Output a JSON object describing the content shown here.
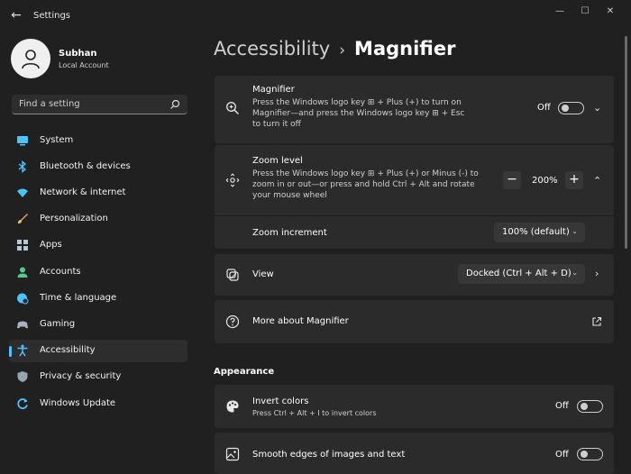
{
  "window": {
    "title": "Settings",
    "minimize_glyph": "—",
    "maximize_glyph": "☐",
    "close_glyph": "✕",
    "back_glyph": "←"
  },
  "user": {
    "name": "Subhan",
    "account_type": "Local Account"
  },
  "search": {
    "placeholder": "Find a setting"
  },
  "nav": {
    "accent_color": "#4cc2ff",
    "items": [
      {
        "label": "System",
        "icon": "monitor-icon"
      },
      {
        "label": "Bluetooth & devices",
        "icon": "bluetooth-icon"
      },
      {
        "label": "Network & internet",
        "icon": "wifi-icon"
      },
      {
        "label": "Personalization",
        "icon": "brush-icon"
      },
      {
        "label": "Apps",
        "icon": "apps-grid-icon"
      },
      {
        "label": "Accounts",
        "icon": "person-icon"
      },
      {
        "label": "Time & language",
        "icon": "globe-clock-icon"
      },
      {
        "label": "Gaming",
        "icon": "gamepad-icon"
      },
      {
        "label": "Accessibility",
        "icon": "accessibility-icon",
        "active": true
      },
      {
        "label": "Privacy & security",
        "icon": "shield-icon"
      },
      {
        "label": "Windows Update",
        "icon": "update-icon"
      }
    ]
  },
  "breadcrumb": {
    "parent": "Accessibility",
    "separator": "›",
    "current": "Magnifier"
  },
  "magnifier": {
    "title": "Magnifier",
    "desc_line1": "Press the Windows logo key ⊞ + Plus (+) to turn on",
    "desc_line2": "Magnifier—and press the Windows logo key ⊞ + Esc",
    "desc_line3": "to turn it off",
    "state": "Off",
    "icon": "magnifier-icon"
  },
  "zoom_level": {
    "title": "Zoom level",
    "desc_line1": "Press the Windows logo key ⊞ + Plus (+) or Minus (-) to",
    "desc_line2": "zoom in or out—or press and hold Ctrl + Alt and rotate",
    "desc_line3": "your mouse wheel",
    "value": "200%",
    "minus": "−",
    "plus": "+",
    "icon": "zoom-level-icon"
  },
  "zoom_increment": {
    "label": "Zoom increment",
    "selected": "100% (default)"
  },
  "view": {
    "title": "View",
    "selected": "Docked (Ctrl + Alt + D)",
    "icon": "view-icon"
  },
  "more_about": {
    "title": "More about Magnifier",
    "icon": "help-icon"
  },
  "appearance": {
    "heading": "Appearance",
    "invert_colors": {
      "title": "Invert colors",
      "desc": "Press Ctrl + Alt + I to invert colors",
      "state": "Off",
      "icon": "palette-icon"
    },
    "smooth_edges": {
      "title": "Smooth edges of images and text",
      "state": "Off",
      "icon": "image-icon"
    }
  }
}
